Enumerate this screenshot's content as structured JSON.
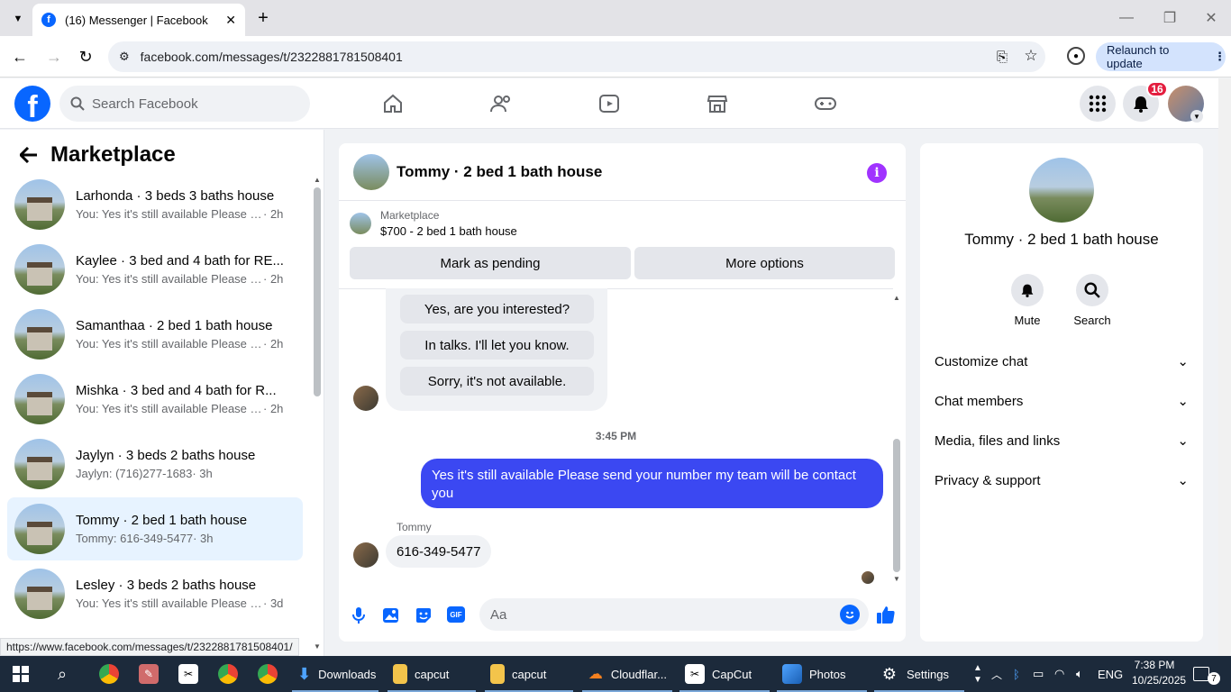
{
  "browser": {
    "tab_title": "(16) Messenger | Facebook",
    "url": "facebook.com/messages/t/2322881781508401",
    "relaunch_label": "Relaunch to update",
    "status_url": "https://www.facebook.com/messages/t/2322881781508401/"
  },
  "fb": {
    "search_placeholder": "Search Facebook",
    "notification_count": "16"
  },
  "left": {
    "title": "Marketplace",
    "conversations": [
      {
        "name": "Larhonda · 3 beds 3 baths house",
        "preview": "You: Yes it's still available Please se...",
        "time": "· 2h"
      },
      {
        "name": "Kaylee · 3 bed and 4 bath for RE...",
        "preview": "You: Yes it's still available Please se...",
        "time": "· 2h"
      },
      {
        "name": "Samanthaa · 2 bed 1 bath house",
        "preview": "You: Yes it's still available Please se...",
        "time": "· 2h"
      },
      {
        "name": "Mishka · 3 bed and 4 bath for R...",
        "preview": "You: Yes it's still available Please se...",
        "time": "· 2h"
      },
      {
        "name": "Jaylyn · 3 beds 2 baths house",
        "preview": "Jaylyn: (716)277-1683",
        "time": "· 3h"
      },
      {
        "name": "Tommy · 2 bed 1 bath house",
        "preview": "Tommy: 616-349-5477",
        "time": "· 3h"
      },
      {
        "name": "Lesley · 3 beds 2 baths house",
        "preview": "You: Yes it's still available Please se...",
        "time": "· 3d"
      }
    ]
  },
  "chat": {
    "title": "Tommy · 2 bed 1 bath house",
    "marketplace_label": "Marketplace",
    "listing": "$700 - 2 bed 1 bath house",
    "mark_pending": "Mark as pending",
    "more_options": "More options",
    "quick_replies": [
      "Yes, are you interested?",
      "In talks. I'll let you know.",
      "Sorry, it's not available."
    ],
    "timestamp": "3:45 PM",
    "outgoing": "Yes it's still available Please send your number my team will be contact you",
    "sender_name": "Tommy",
    "incoming": "616-349-5477",
    "input_placeholder": "Aa",
    "gif_label": "GIF"
  },
  "right": {
    "name": "Tommy · 2 bed 1 bath house",
    "mute": "Mute",
    "search": "Search",
    "sections": [
      "Customize chat",
      "Chat members",
      "Media, files and links",
      "Privacy & support"
    ]
  },
  "taskbar": {
    "items": [
      "Downloads",
      "capcut",
      "capcut",
      "Cloudflar...",
      "CapCut",
      "Photos",
      "Settings"
    ],
    "lang": "ENG",
    "time": "7:38 PM",
    "date": "10/25/2025",
    "notif_count": "7"
  },
  "colors": {
    "accent": "#0866ff",
    "outgoing_bubble": "#3b48f2",
    "selected_row": "#e7f3ff",
    "info": "#a033ff"
  }
}
